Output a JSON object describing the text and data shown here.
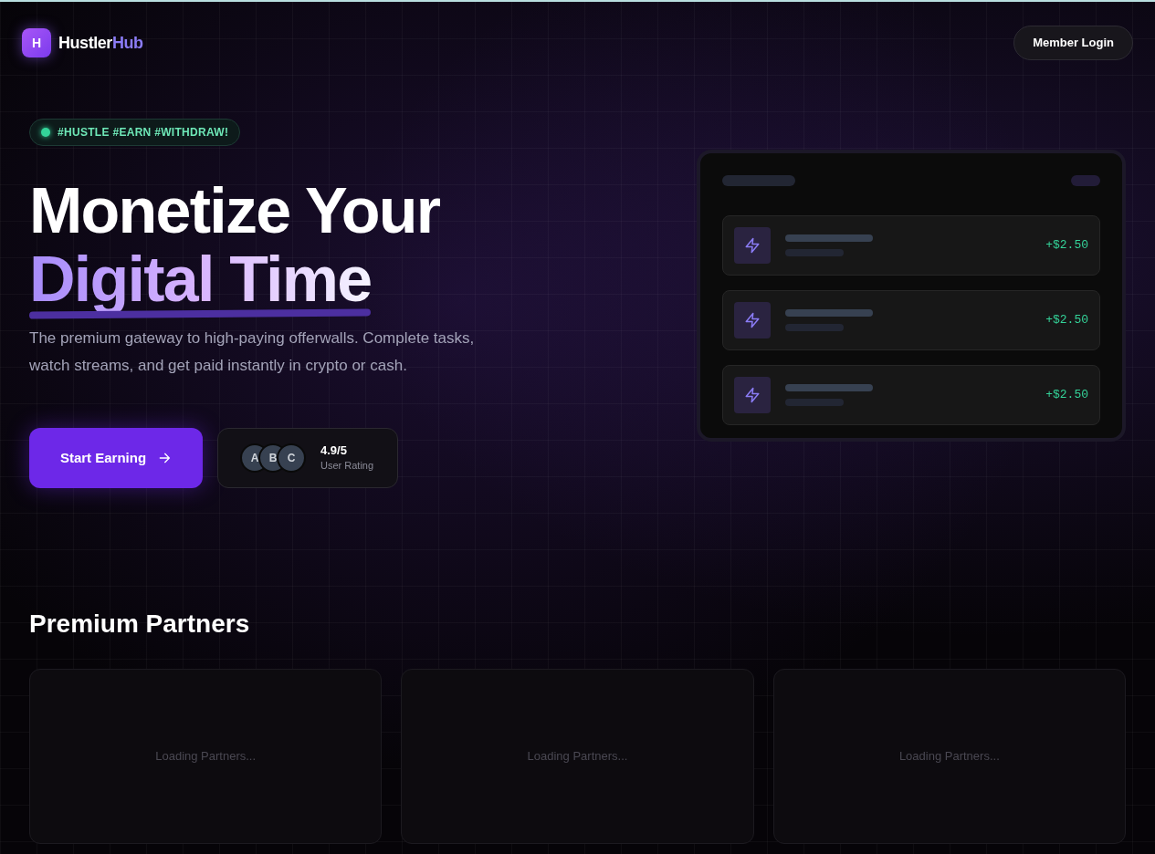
{
  "brand": {
    "initial": "H",
    "name": "Hustler",
    "accent": "Hub"
  },
  "header": {
    "login_button": "Member Login"
  },
  "hero": {
    "badge": "#HUSTLE #EARN #WITHDRAW!",
    "title_line_1": "Monetize Your",
    "title_line_2": "Digital Time",
    "description": "The premium gateway to high-paying offerwalls. Complete tasks, watch streams, and get paid instantly in crypto or cash.",
    "cta": "Start Earning",
    "rating": {
      "avatars": [
        "A",
        "B",
        "C"
      ],
      "score": "4.9/5",
      "label": "User Rating"
    }
  },
  "preview": {
    "rows": [
      {
        "amount": "+$2.50"
      },
      {
        "amount": "+$2.50"
      },
      {
        "amount": "+$2.50"
      }
    ]
  },
  "partners": {
    "title": "Premium Partners",
    "cards": [
      {
        "text": "Loading Partners..."
      },
      {
        "text": "Loading Partners..."
      },
      {
        "text": "Loading Partners..."
      }
    ]
  }
}
